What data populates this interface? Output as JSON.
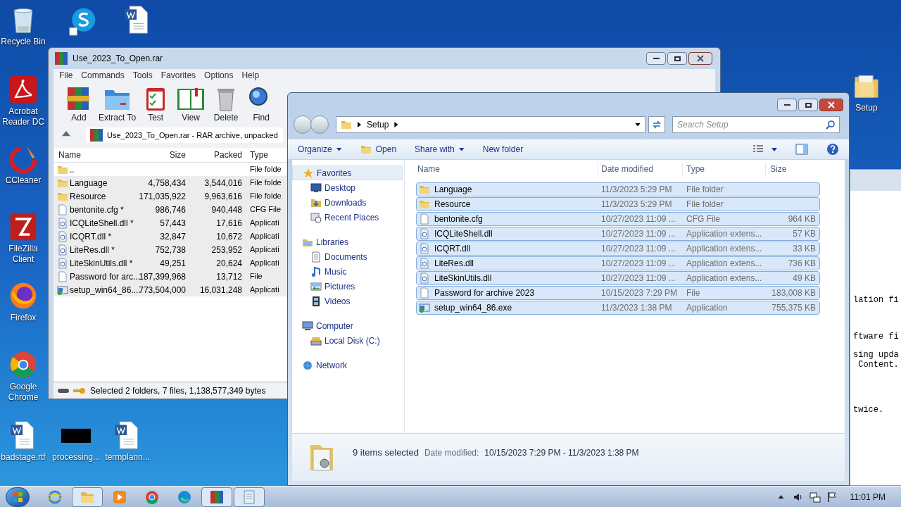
{
  "desktop_icons": [
    {
      "label": "Recycle Bin",
      "kind": "recycle"
    },
    {
      "label": "Acrobat Reader DC",
      "kind": "acrobat"
    },
    {
      "label": "CCleaner",
      "kind": "ccleaner"
    },
    {
      "label": "FileZilla Client",
      "kind": "filezilla"
    },
    {
      "label": "Firefox",
      "kind": "firefox"
    },
    {
      "label": "Google Chrome",
      "kind": "chrome"
    },
    {
      "label": "badstage.rtf",
      "kind": "word"
    },
    {
      "label": "processing...",
      "kind": "black"
    },
    {
      "label": "termplann...",
      "kind": "word"
    },
    {
      "label": "Setup",
      "kind": "folder"
    },
    {
      "kind": "skype"
    },
    {
      "kind": "word"
    }
  ],
  "winrar": {
    "title": "Use_2023_To_Open.rar",
    "menu": [
      "File",
      "Commands",
      "Tools",
      "Favorites",
      "Options",
      "Help"
    ],
    "toolbar": [
      {
        "label": "Add",
        "kind": "add"
      },
      {
        "label": "Extract To",
        "kind": "extract"
      },
      {
        "label": "Test",
        "kind": "test"
      },
      {
        "label": "View",
        "kind": "view"
      },
      {
        "label": "Delete",
        "kind": "delete"
      },
      {
        "label": "Find",
        "kind": "find"
      }
    ],
    "address": "Use_2023_To_Open.rar - RAR archive, unpacked",
    "columns": [
      "Name",
      "Size",
      "Packed",
      "Type"
    ],
    "rows": [
      {
        "name": "..",
        "size": "",
        "packed": "",
        "type": "File folde",
        "kind": "folder",
        "selected": false
      },
      {
        "name": "Language",
        "size": "4,758,434",
        "packed": "3,544,016",
        "type": "File folde",
        "kind": "folder",
        "selected": true
      },
      {
        "name": "Resource",
        "size": "171,035,922",
        "packed": "9,963,616",
        "type": "File folde",
        "kind": "folder",
        "selected": true
      },
      {
        "name": "bentonite.cfg *",
        "size": "986,746",
        "packed": "940,448",
        "type": "CFG File",
        "kind": "file",
        "selected": true
      },
      {
        "name": "ICQLiteShell.dll *",
        "size": "57,443",
        "packed": "17,616",
        "type": "Applicati",
        "kind": "dll",
        "selected": true
      },
      {
        "name": "ICQRT.dll *",
        "size": "32,847",
        "packed": "10,672",
        "type": "Applicati",
        "kind": "dll",
        "selected": true
      },
      {
        "name": "LiteRes.dll *",
        "size": "752,738",
        "packed": "253,952",
        "type": "Applicati",
        "kind": "dll",
        "selected": true
      },
      {
        "name": "LiteSkinUtils.dll *",
        "size": "49,251",
        "packed": "20,624",
        "type": "Applicati",
        "kind": "dll",
        "selected": true
      },
      {
        "name": "Password for arc...",
        "size": "187,399,968",
        "packed": "13,712",
        "type": "File",
        "kind": "file",
        "selected": true
      },
      {
        "name": "setup_win64_86....",
        "size": "773,504,000",
        "packed": "16,031,248",
        "type": "Applicati",
        "kind": "exe",
        "selected": true
      }
    ],
    "status": "Selected 2 folders, 7 files, 1,138,577,349 bytes"
  },
  "explorer": {
    "crumbs": [
      "Setup"
    ],
    "search": {
      "placeholder": "Search Setup"
    },
    "commands": [
      {
        "label": "Organize",
        "kind": "menu"
      },
      {
        "label": "Open",
        "kind": "open"
      },
      {
        "label": "Share with",
        "kind": "menu"
      },
      {
        "label": "New folder",
        "kind": "plain"
      }
    ],
    "nav": [
      {
        "label": "Favorites",
        "kind": "star",
        "selected": true,
        "children": [
          {
            "label": "Desktop",
            "kind": "desktop"
          },
          {
            "label": "Downloads",
            "kind": "downloads"
          },
          {
            "label": "Recent Places",
            "kind": "recent"
          }
        ]
      },
      {
        "label": "Libraries",
        "kind": "library",
        "selected": false,
        "children": [
          {
            "label": "Documents",
            "kind": "documents"
          },
          {
            "label": "Music",
            "kind": "music"
          },
          {
            "label": "Pictures",
            "kind": "pictures"
          },
          {
            "label": "Videos",
            "kind": "videos"
          }
        ]
      },
      {
        "label": "Computer",
        "kind": "computer",
        "selected": false,
        "children": [
          {
            "label": "Local Disk (C:)",
            "kind": "disk"
          }
        ]
      },
      {
        "label": "Network",
        "kind": "network",
        "selected": false
      }
    ],
    "columns": [
      "Name",
      "Date modified",
      "Type",
      "Size"
    ],
    "rows": [
      {
        "name": "Language",
        "date": "11/3/2023 5:29 PM",
        "type": "File folder",
        "size": "",
        "kind": "folder",
        "selected": true
      },
      {
        "name": "Resource",
        "date": "11/3/2023 5:29 PM",
        "type": "File folder",
        "size": "",
        "kind": "folder",
        "selected": true
      },
      {
        "name": "bentonite.cfg",
        "date": "10/27/2023 11:09 ...",
        "type": "CFG File",
        "size": "964 KB",
        "kind": "file",
        "selected": true
      },
      {
        "name": "ICQLiteShell.dll",
        "date": "10/27/2023 11:09 ...",
        "type": "Application extens...",
        "size": "57 KB",
        "kind": "dll",
        "selected": true
      },
      {
        "name": "ICQRT.dll",
        "date": "10/27/2023 11:09 ...",
        "type": "Application extens...",
        "size": "33 KB",
        "kind": "dll",
        "selected": true
      },
      {
        "name": "LiteRes.dll",
        "date": "10/27/2023 11:09 ...",
        "type": "Application extens...",
        "size": "736 KB",
        "kind": "dll",
        "selected": true
      },
      {
        "name": "LiteSkinUtils.dll",
        "date": "10/27/2023 11:09 ...",
        "type": "Application extens...",
        "size": "49 KB",
        "kind": "dll",
        "selected": true
      },
      {
        "name": "Password for archive 2023",
        "date": "10/15/2023 7:29 PM",
        "type": "File",
        "size": "183,008 KB",
        "kind": "file",
        "selected": true
      },
      {
        "name": "setup_win64_86.exe",
        "date": "11/3/2023 1:38 PM",
        "type": "Application",
        "size": "755,375 KB",
        "kind": "exe",
        "selected": true
      }
    ],
    "details": {
      "count": "9 items selected",
      "label": "Date modified:",
      "value": "10/15/2023 7:29 PM - 11/3/2023 1:38 PM"
    }
  },
  "back_window": {
    "lines": [
      {
        "text": "lation fi"
      },
      {
        "text": "ftware fi"
      },
      {
        "text": "sing upda"
      },
      {
        "text": " Content."
      },
      {
        "text": "twice."
      }
    ]
  },
  "taskbar": {
    "items": [
      {
        "kind": "ie",
        "open": false
      },
      {
        "kind": "explorer",
        "open": true
      },
      {
        "kind": "media",
        "open": false
      },
      {
        "kind": "chrome",
        "open": false
      },
      {
        "kind": "edge",
        "open": false
      },
      {
        "kind": "winrar",
        "open": true
      },
      {
        "kind": "notepad",
        "open": true
      }
    ],
    "clock": "11:01 PM"
  }
}
